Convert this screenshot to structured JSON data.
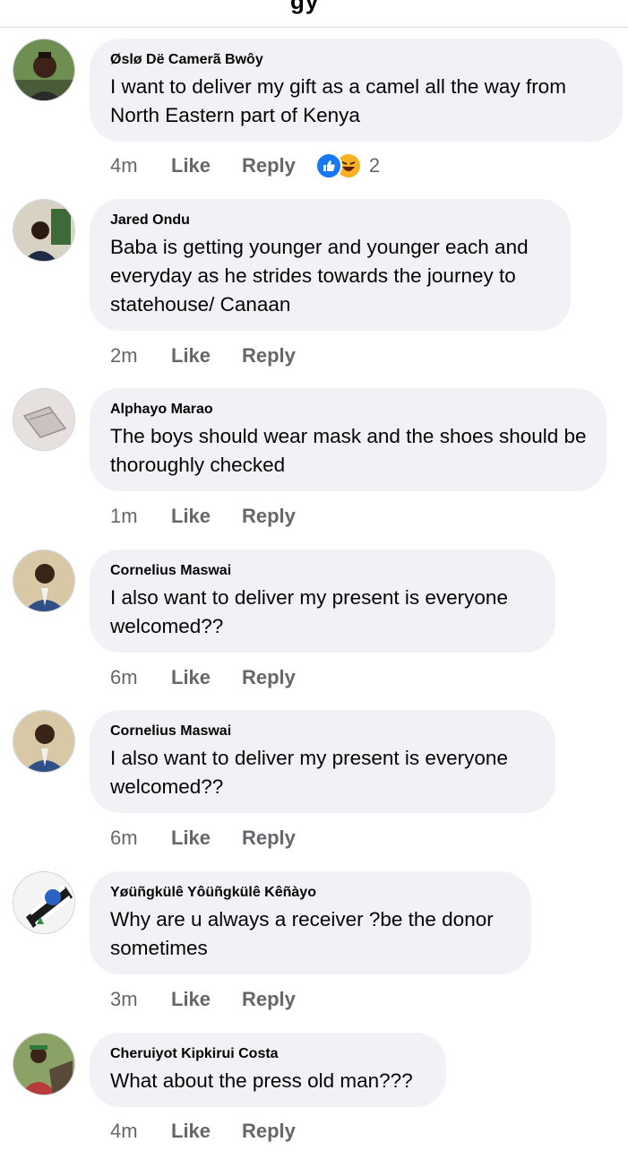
{
  "header": {
    "partial_title": "gy"
  },
  "comments": [
    {
      "author": "Øslø Dë Camerã Bwôy",
      "text": "I want to deliver my gift as a camel all the way from North Eastern part of Kenya",
      "time": "4m",
      "like": "Like",
      "reply": "Reply",
      "reaction_count": "2",
      "reactions": [
        "like-icon",
        "haha-icon"
      ]
    },
    {
      "author": "Jared Ondu",
      "text": "Baba is getting younger and younger each and everyday as he strides towards the journey to statehouse/ Canaan",
      "time": "2m",
      "like": "Like",
      "reply": "Reply"
    },
    {
      "author": "Alphayo Marao",
      "text": "The boys should wear mask and the shoes should be thoroughly checked",
      "time": "1m",
      "like": "Like",
      "reply": "Reply"
    },
    {
      "author": "Cornelius Maswai",
      "text": "I also want to deliver my present is everyone welcomed??",
      "time": "6m",
      "like": "Like",
      "reply": "Reply"
    },
    {
      "author": "Cornelius Maswai",
      "text": "I also want to deliver my present is everyone welcomed??",
      "time": "6m",
      "like": "Like",
      "reply": "Reply"
    },
    {
      "author": "Yøüñgkülê Yôüñgkülê Kêñàyo",
      "text": "Why are u always a receiver ?be the donor sometimes",
      "time": "3m",
      "like": "Like",
      "reply": "Reply"
    },
    {
      "author": "Cheruiyot Kipkirui Costa",
      "text": "What about the press old man???",
      "time": "4m",
      "like": "Like",
      "reply": "Reply"
    }
  ],
  "colors": {
    "bubble": "#f0f2f5",
    "meta": "#65676b",
    "like_blue": "#1877f2",
    "haha_yellow": "#f7b125"
  }
}
